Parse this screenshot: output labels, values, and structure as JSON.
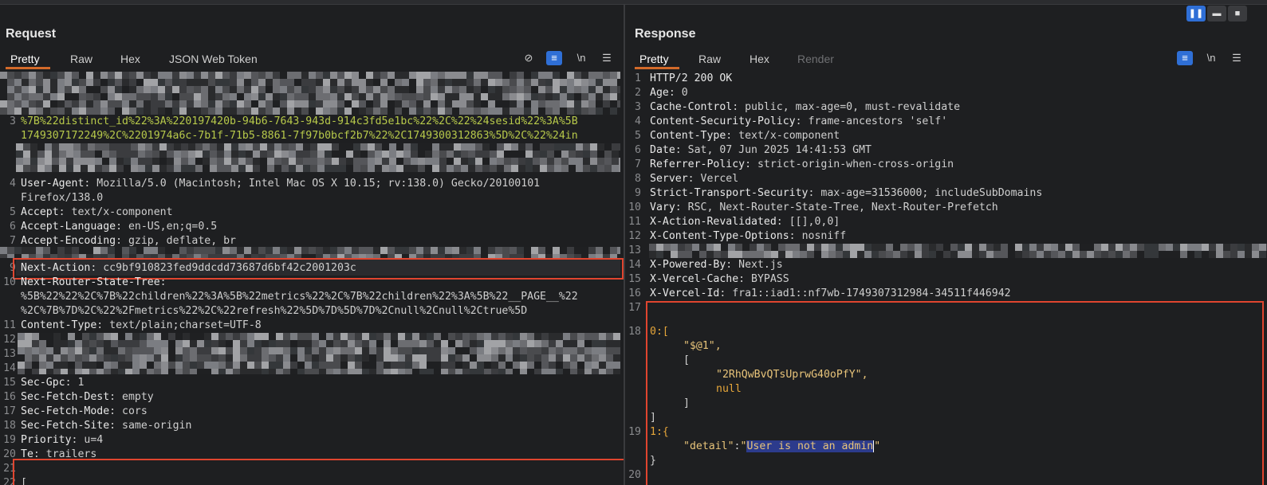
{
  "view_buttons": [
    {
      "icon": "split-horizontal-icon",
      "active": true
    },
    {
      "icon": "split-vertical-icon",
      "active": false
    },
    {
      "icon": "single-pane-icon",
      "active": false
    }
  ],
  "request": {
    "title": "Request",
    "tabs": [
      {
        "label": "Pretty",
        "active": true
      },
      {
        "label": "Raw"
      },
      {
        "label": "Hex"
      },
      {
        "label": "JSON Web Token"
      }
    ],
    "tools": {
      "hide_icon": "eye-off-icon",
      "wrap_icon": "wrap-lines-icon",
      "newline": "\\n",
      "menu_icon": "menu-icon"
    },
    "lines": [
      {
        "n": "3",
        "key": "",
        "value": "%7B%22distinct_id%22%3A%220197420b-94b6-7643-943d-914c3fd5e1bc%22%2C%22%24sesid%22%3A%5B",
        "style": "green"
      },
      {
        "n": "",
        "key": "",
        "value": "1749307172249%2C%2201974a6c-7b1f-71b5-8861-7f97b0bcf2b7%22%2C1749300312863%5D%2C%22%24in",
        "style": "green"
      },
      {
        "n": "4",
        "key": "User-Agent",
        "value": " Mozilla/5.0 (Macintosh; Intel Mac OS X 10.15; rv:138.0) Gecko/20100101"
      },
      {
        "n": "",
        "key": "",
        "value": "Firefox/138.0"
      },
      {
        "n": "5",
        "key": "Accept",
        "value": " text/x-component"
      },
      {
        "n": "6",
        "key": "Accept-Language",
        "value": " en-US,en;q=0.5"
      },
      {
        "n": "7",
        "key": "Accept-Encoding",
        "value": " gzip, deflate, br"
      },
      {
        "n": "9",
        "key": "Next-Action",
        "value": " cc9bf910823fed9ddcdd73687d6bf42c2001203c"
      },
      {
        "n": "10",
        "key": "Next-Router-State-Tree",
        "value": ""
      },
      {
        "n": "",
        "key": "",
        "value": "%5B%22%22%2C%7B%22children%22%3A%5B%22metrics%22%2C%7B%22children%22%3A%5B%22__PAGE__%22"
      },
      {
        "n": "",
        "key": "",
        "value": "%2C%7B%7D%2C%22%2Fmetrics%22%2C%22refresh%22%5D%7D%5D%7D%2Cnull%2Cnull%2Ctrue%5D"
      },
      {
        "n": "11",
        "key": "Content-Type",
        "value": " text/plain;charset=UTF-8"
      },
      {
        "n": "12",
        "key": "",
        "value": ""
      },
      {
        "n": "13",
        "key": "",
        "value": ""
      },
      {
        "n": "14",
        "key": "",
        "value": ""
      },
      {
        "n": "15",
        "key": "Sec-Gpc",
        "value": " 1"
      },
      {
        "n": "16",
        "key": "Sec-Fetch-Dest",
        "value": " empty"
      },
      {
        "n": "17",
        "key": "Sec-Fetch-Mode",
        "value": " cors"
      },
      {
        "n": "18",
        "key": "Sec-Fetch-Site",
        "value": " same-origin"
      },
      {
        "n": "19",
        "key": "Priority",
        "value": " u=4"
      },
      {
        "n": "20",
        "key": "Te",
        "value": " trailers"
      },
      {
        "n": "21",
        "key": "",
        "value": ""
      },
      {
        "n": "22",
        "key": "",
        "value": "["
      }
    ]
  },
  "response": {
    "title": "Response",
    "tabs": [
      {
        "label": "Pretty",
        "active": true
      },
      {
        "label": "Raw"
      },
      {
        "label": "Hex"
      },
      {
        "label": "Render",
        "disabled": true
      }
    ],
    "tools": {
      "wrap_icon": "wrap-lines-icon",
      "newline": "\\n",
      "menu_icon": "menu-icon"
    },
    "headers": [
      {
        "n": "1",
        "key": "",
        "value": "HTTP/2 200 OK"
      },
      {
        "n": "2",
        "key": "Age",
        "value": " 0"
      },
      {
        "n": "3",
        "key": "Cache-Control",
        "value": " public, max-age=0, must-revalidate"
      },
      {
        "n": "4",
        "key": "Content-Security-Policy",
        "value": " frame-ancestors 'self'"
      },
      {
        "n": "5",
        "key": "Content-Type",
        "value": " text/x-component"
      },
      {
        "n": "6",
        "key": "Date",
        "value": " Sat, 07 Jun 2025 14:41:53 GMT"
      },
      {
        "n": "7",
        "key": "Referrer-Policy",
        "value": " strict-origin-when-cross-origin"
      },
      {
        "n": "8",
        "key": "Server",
        "value": " Vercel"
      },
      {
        "n": "9",
        "key": "Strict-Transport-Security",
        "value": " max-age=31536000; includeSubDomains"
      },
      {
        "n": "10",
        "key": "Vary",
        "value": " RSC, Next-Router-State-Tree, Next-Router-Prefetch"
      },
      {
        "n": "11",
        "key": "X-Action-Revalidated",
        "value": " [[],0,0]"
      },
      {
        "n": "12",
        "key": "X-Content-Type-Options",
        "value": " nosniff"
      },
      {
        "n": "13",
        "key": "",
        "value": ""
      },
      {
        "n": "14",
        "key": "X-Powered-By",
        "value": " Next.js"
      },
      {
        "n": "15",
        "key": "X-Vercel-Cache",
        "value": " BYPASS"
      },
      {
        "n": "16",
        "key": "X-Vercel-Id",
        "value": " fra1::iad1::nf7wb-1749307312984-34511f446942"
      },
      {
        "n": "17",
        "key": "",
        "value": ""
      }
    ],
    "body": {
      "l18_prefix": "0:[",
      "item1": "\"$@1\",",
      "open_bracket": "[",
      "item2": "\"2RhQwBvQTsUprwG40oPfY\",",
      "null_value": "null",
      "close_inner": "]",
      "close_outer": "]",
      "l19_prefix": "1:{",
      "detail_key": "\"detail\"",
      "colon": ":",
      "quote_open": "\"",
      "detail_value": "User is not an admin",
      "quote_close": "\"",
      "close_brace": "}",
      "n18": "18",
      "n19": "19",
      "n20": "20"
    }
  }
}
